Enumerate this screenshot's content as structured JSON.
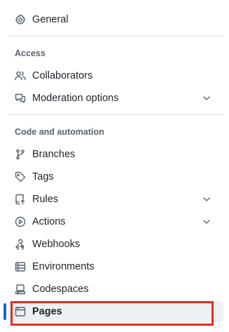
{
  "nav": {
    "general": {
      "label": "General",
      "icon": "gear-icon"
    },
    "access_heading": "Access",
    "collaborators": {
      "label": "Collaborators",
      "icon": "people-icon"
    },
    "moderation": {
      "label": "Moderation options",
      "icon": "comment-discussion-icon",
      "expandable": true
    },
    "code_heading": "Code and automation",
    "branches": {
      "label": "Branches",
      "icon": "git-branch-icon"
    },
    "tags": {
      "label": "Tags",
      "icon": "tag-icon"
    },
    "rules": {
      "label": "Rules",
      "icon": "repo-push-icon",
      "expandable": true
    },
    "actions": {
      "label": "Actions",
      "icon": "play-icon",
      "expandable": true
    },
    "webhooks": {
      "label": "Webhooks",
      "icon": "webhook-icon"
    },
    "environments": {
      "label": "Environments",
      "icon": "server-icon"
    },
    "codespaces": {
      "label": "Codespaces",
      "icon": "codespaces-icon"
    },
    "pages": {
      "label": "Pages",
      "icon": "browser-icon",
      "active": true
    }
  },
  "colors": {
    "accent": "#0969da",
    "highlight_outline": "#d93025",
    "heading": "#59636e",
    "divider": "#d8dee4"
  }
}
